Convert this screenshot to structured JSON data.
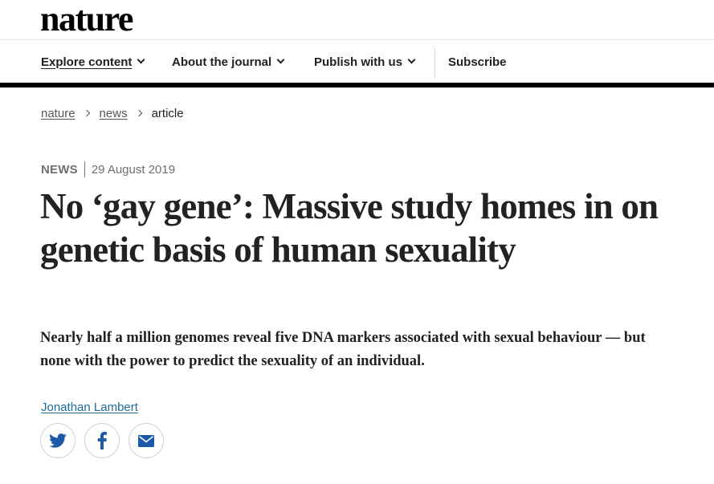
{
  "site": {
    "logo_text": "nature"
  },
  "nav": {
    "items": [
      {
        "label": "Explore content",
        "has_dropdown": true
      },
      {
        "label": "About the journal",
        "has_dropdown": true
      },
      {
        "label": "Publish with us",
        "has_dropdown": true
      },
      {
        "label": "Subscribe",
        "has_dropdown": false
      }
    ]
  },
  "breadcrumb": {
    "items": [
      {
        "label": "nature"
      },
      {
        "label": "news"
      },
      {
        "label": "article"
      }
    ]
  },
  "article": {
    "type": "NEWS",
    "date": "29 August 2019",
    "title": "No ‘gay gene’: Massive study homes in on genetic basis of human sexuality",
    "standfirst": "Nearly half a million genomes reveal five DNA markers associated with sexual behaviour — but none with the power to predict the sexuality of an individual.",
    "author": "Jonathan Lambert"
  },
  "share": {
    "icons": [
      "twitter-icon",
      "facebook-icon",
      "email-icon"
    ]
  },
  "colors": {
    "text": "#222222",
    "nav_bar": "#000000",
    "author_link": "#1d6b9a",
    "share_icon": "#1c5aa8",
    "muted": "#6f6f6f"
  }
}
